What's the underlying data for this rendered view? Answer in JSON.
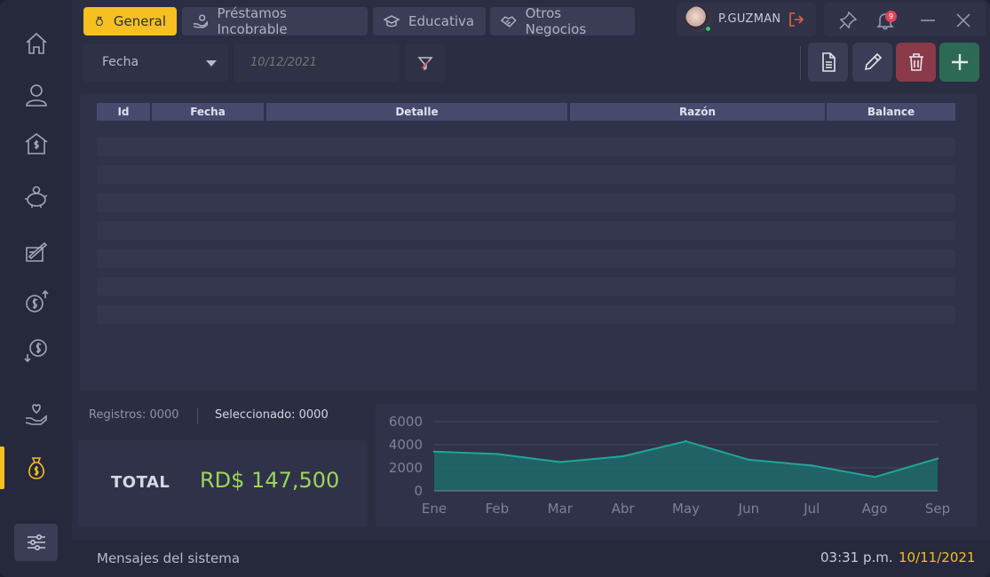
{
  "tabs": [
    {
      "label": "General",
      "icon": "money-bag-icon",
      "active": true
    },
    {
      "label": "Préstamos Incobrable",
      "icon": "hand-money-icon",
      "active": false
    },
    {
      "label": "Educativa",
      "icon": "graduation-cap-icon",
      "active": false
    },
    {
      "label": "Otros Negocios",
      "icon": "handshake-icon",
      "active": false
    }
  ],
  "user": {
    "name": "P.GUZMAN",
    "notifications": "9"
  },
  "toolbar": {
    "sort_value": "Fecha",
    "date_placeholder": "10/12/2021"
  },
  "table": {
    "columns": [
      "Id",
      "Fecha",
      "Detalle",
      "Razón",
      "Balance"
    ]
  },
  "summary": {
    "records": "Registros: 0000",
    "selected": "Seleccionado: 0000",
    "total_label": "TOTAL",
    "total_value": "RD$ 147,500"
  },
  "status": {
    "message": "Mensajes del sistema",
    "time": "03:31 p.m.",
    "date": "10/11/2021"
  },
  "colors": {
    "accent": "#f5c020",
    "total": "#9cd65a",
    "chart": "#1fa699",
    "delete": "#8a3a48",
    "add": "#2c6a55"
  },
  "chart_data": {
    "type": "area",
    "categories": [
      "Ene",
      "Feb",
      "Mar",
      "Abr",
      "May",
      "Jun",
      "Jul",
      "Ago",
      "Sep"
    ],
    "values": [
      3400,
      3200,
      2500,
      3000,
      4300,
      2700,
      2200,
      1200,
      2800
    ],
    "yticks": [
      "0",
      "2000",
      "4000",
      "6000"
    ],
    "ylim": [
      0,
      6000
    ],
    "grid": true
  }
}
